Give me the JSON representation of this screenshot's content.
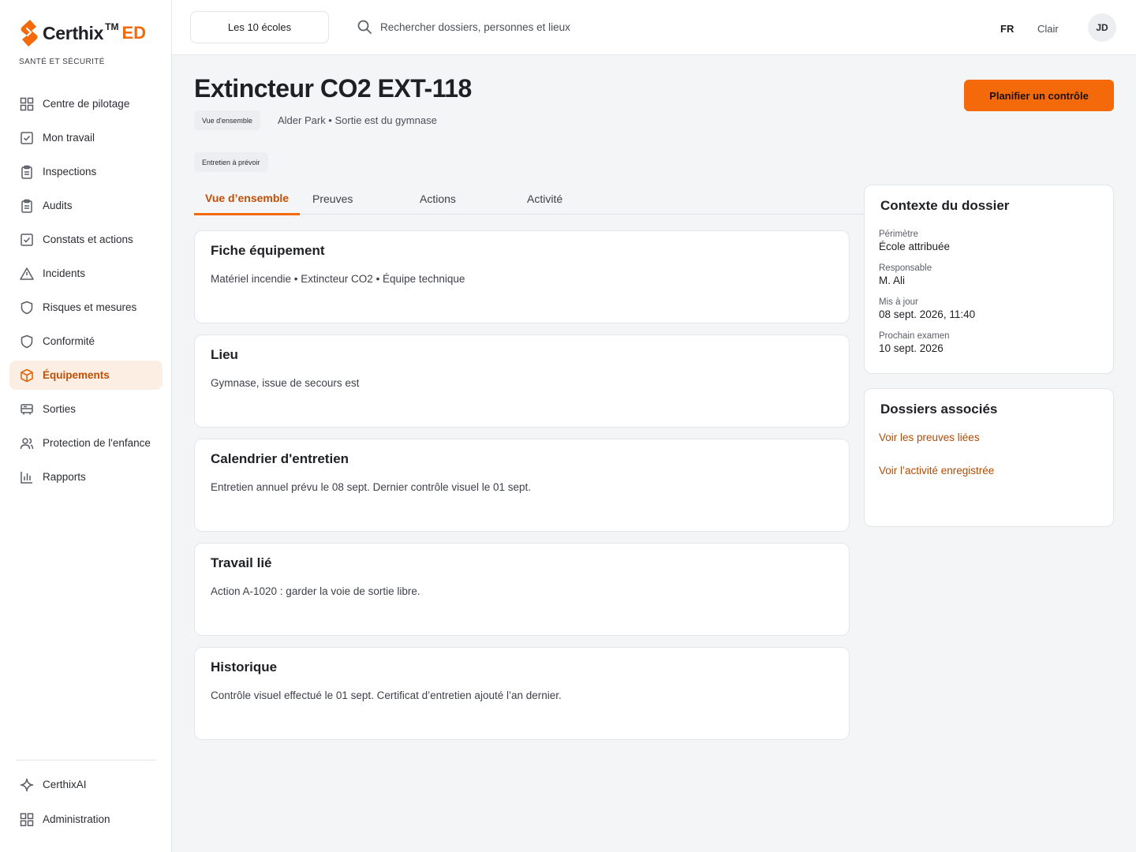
{
  "brand": {
    "name": "Certhix",
    "tm": "TM",
    "suffix": "ED",
    "subtitle": "SANTÉ ET SÉCURITÉ",
    "accent": "#f46a0b"
  },
  "sidebar": {
    "items": [
      {
        "label": "Centre de pilotage",
        "icon": "grid-icon"
      },
      {
        "label": "Mon travail",
        "icon": "checkbox-icon"
      },
      {
        "label": "Inspections",
        "icon": "clipboard-icon"
      },
      {
        "label": "Audits",
        "icon": "clipboard-icon"
      },
      {
        "label": "Constats et actions",
        "icon": "checkbox-icon"
      },
      {
        "label": "Incidents",
        "icon": "warning-icon"
      },
      {
        "label": "Risques et mesures",
        "icon": "shield-icon"
      },
      {
        "label": "Conformité",
        "icon": "shield-icon"
      },
      {
        "label": "Équipements",
        "icon": "box-icon",
        "active": true
      },
      {
        "label": "Sorties",
        "icon": "bus-icon"
      },
      {
        "label": "Protection de l'enfance",
        "icon": "people-icon"
      },
      {
        "label": "Rapports",
        "icon": "bar-chart-icon"
      }
    ],
    "bottom": [
      {
        "label": "CerthixAI",
        "icon": "sparkle-icon"
      },
      {
        "label": "Administration",
        "icon": "grid-icon"
      }
    ]
  },
  "topbar": {
    "scope": "Les 10 écoles",
    "search_placeholder": "Rechercher dossiers, personnes et lieux",
    "lang": "FR",
    "theme": "Clair",
    "avatar": "JD"
  },
  "header": {
    "title": "Extincteur CO2 EXT-118",
    "overview_chip": "Vue d'ensemble",
    "location": "Alder Park • Sortie est du gymnase",
    "status_chip": "Entretien à prévoir",
    "primary_action": "Planifier un contrôle"
  },
  "tabs": [
    "Vue d’ensemble",
    "Preuves",
    "Actions",
    "Activité"
  ],
  "cards": [
    {
      "title": "Fiche équipement",
      "body": "Matériel incendie • Extincteur CO2 • Équipe technique"
    },
    {
      "title": "Lieu",
      "body": "Gymnase, issue de secours est"
    },
    {
      "title": "Calendrier d'entretien",
      "body": "Entretien annuel prévu le 08 sept. Dernier contrôle visuel le 01 sept."
    },
    {
      "title": "Travail lié",
      "body": "Action A-1020 : garder la voie de sortie libre."
    },
    {
      "title": "Historique",
      "body": "Contrôle visuel effectué le 01 sept. Certificat d’entretien ajouté l’an dernier."
    }
  ],
  "context": {
    "title": "Contexte du dossier",
    "fields": [
      {
        "label": "Périmètre",
        "value": "École attribuée"
      },
      {
        "label": "Responsable",
        "value": "M. Ali"
      },
      {
        "label": "Mis à jour",
        "value": "08 sept. 2026, 11:40"
      },
      {
        "label": "Prochain examen",
        "value": "10 sept. 2026"
      }
    ]
  },
  "related": {
    "title": "Dossiers associés",
    "links": [
      "Voir les preuves liées",
      "Voir l’activité enregistrée"
    ]
  }
}
